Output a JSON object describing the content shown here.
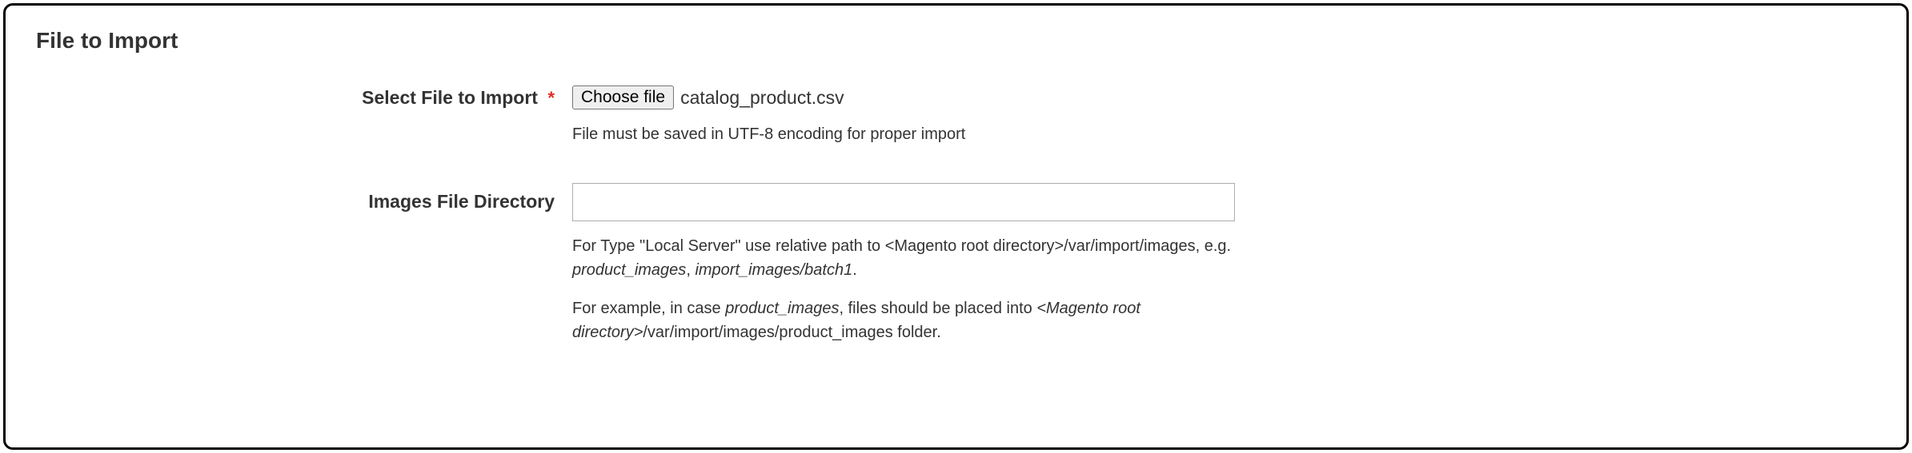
{
  "panel": {
    "title": "File to Import"
  },
  "fields": {
    "select_file": {
      "label": "Select File to Import",
      "required_symbol": "*",
      "button_label": "Choose file",
      "chosen_file": "catalog_product.csv",
      "note": "File must be saved in UTF-8 encoding for proper import"
    },
    "images_dir": {
      "label": "Images File Directory",
      "value": "",
      "note1_pre": "For Type \"Local Server\" use relative path to <Magento root directory>/var/import/images, e.g. ",
      "note1_em1": "product_images",
      "note1_mid": ", ",
      "note1_em2": "import_images/batch1",
      "note1_end": ".",
      "note2_pre": "For example, in case ",
      "note2_em1": "product_images",
      "note2_mid": ", files should be placed into ",
      "note2_em2": "<Magento root directory>",
      "note2_end": "/var/import/images/product_images folder."
    }
  }
}
